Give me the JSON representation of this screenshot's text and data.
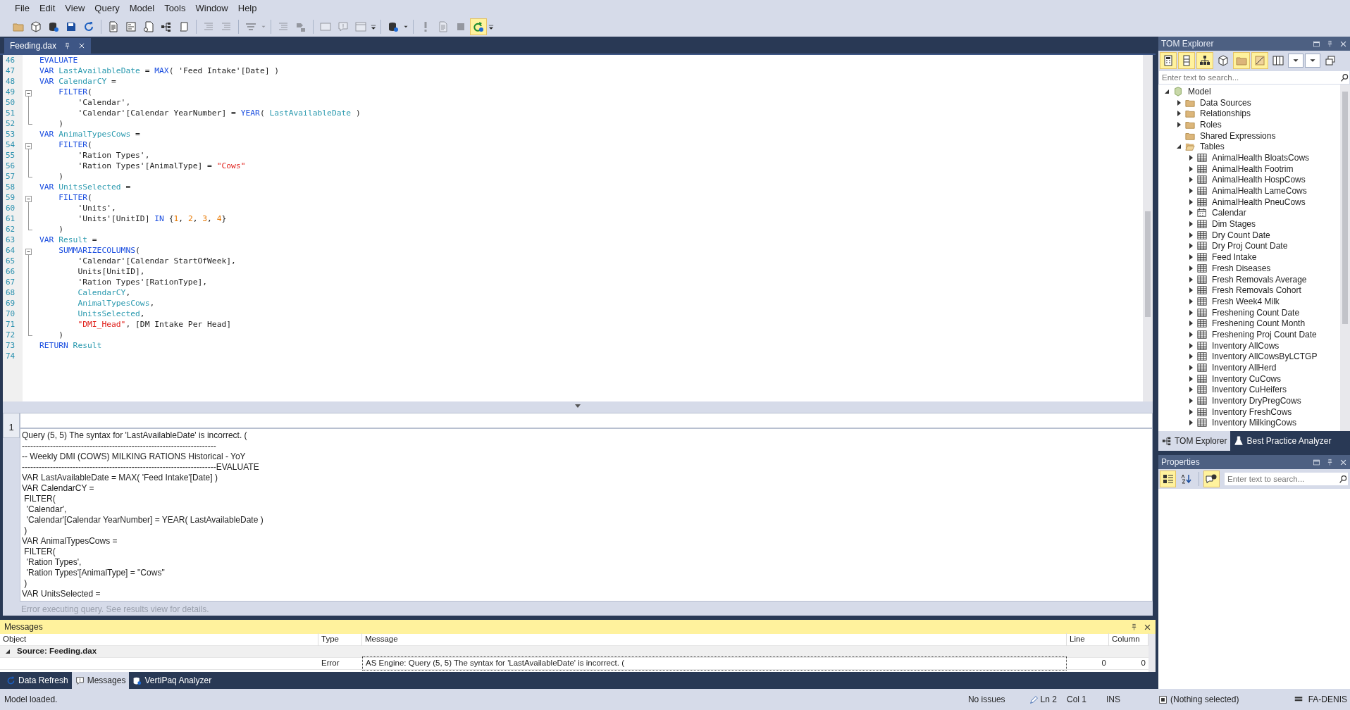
{
  "menu": [
    "File",
    "Edit",
    "View",
    "Query",
    "Model",
    "Tools",
    "Window",
    "Help"
  ],
  "toolbar": [
    {
      "kind": "folder",
      "disabled": false
    },
    {
      "kind": "cube",
      "disabled": false
    },
    {
      "kind": "database",
      "disabled": false
    },
    {
      "kind": "save",
      "disabled": false
    },
    {
      "kind": "refresh",
      "disabled": false
    },
    {
      "kind": "separator"
    },
    {
      "kind": "document",
      "disabled": false
    },
    {
      "kind": "form",
      "disabled": false
    },
    {
      "kind": "script",
      "disabled": false
    },
    {
      "kind": "tree",
      "disabled": false
    },
    {
      "kind": "scroll",
      "disabled": false
    },
    {
      "kind": "separator"
    },
    {
      "kind": "lines",
      "disabled": true
    },
    {
      "kind": "lines",
      "disabled": true
    },
    {
      "kind": "separator"
    },
    {
      "kind": "align",
      "disabled": true,
      "dropdown": true
    },
    {
      "kind": "separator"
    },
    {
      "kind": "lines",
      "disabled": true
    },
    {
      "kind": "arrow",
      "disabled": true
    },
    {
      "kind": "separator"
    },
    {
      "kind": "box",
      "disabled": true
    },
    {
      "kind": "chat",
      "disabled": true
    },
    {
      "kind": "panel",
      "disabled": true
    },
    {
      "kind": "overflow"
    },
    {
      "kind": "separator"
    },
    {
      "kind": "database",
      "disabled": false,
      "dropdown": true
    },
    {
      "kind": "separator"
    },
    {
      "kind": "exclaim",
      "disabled": true
    },
    {
      "kind": "document",
      "disabled": true
    },
    {
      "kind": "stop",
      "disabled": true
    },
    {
      "kind": "run",
      "disabled": false,
      "checked": true
    },
    {
      "kind": "overflow"
    }
  ],
  "document_tab": {
    "title": "Feeding.dax",
    "selected": true
  },
  "editor": {
    "lines": [
      {
        "number": "46",
        "kind": "plain",
        "tokens": [
          {
            "kind": "kw",
            "text": "EVALUATE"
          }
        ]
      },
      {
        "number": "47",
        "kind": "plain",
        "tokens": [
          {
            "kind": "kw",
            "text": "VAR "
          },
          {
            "kind": "var",
            "text": "LastAvailableDate"
          },
          {
            "kind": "txt",
            "text": " = "
          },
          {
            "kind": "kw",
            "text": "MAX"
          },
          {
            "kind": "txt",
            "text": "( 'Feed Intake'[Date] )"
          }
        ]
      },
      {
        "number": "48",
        "kind": "plain",
        "tokens": [
          {
            "kind": "kw",
            "text": "VAR "
          },
          {
            "kind": "var",
            "text": "CalendarCY"
          },
          {
            "kind": "txt",
            "text": " ="
          }
        ]
      },
      {
        "number": "49",
        "kind": "fold_start",
        "tokens": [
          {
            "kind": "kw",
            "text": "    FILTER"
          },
          {
            "kind": "txt",
            "text": "("
          }
        ]
      },
      {
        "number": "50",
        "kind": "fold_inside",
        "tokens": [
          {
            "kind": "txt",
            "text": "        'Calendar',"
          }
        ]
      },
      {
        "number": "51",
        "kind": "fold_inside",
        "tokens": [
          {
            "kind": "txt",
            "text": "        'Calendar'[Calendar YearNumber] = "
          },
          {
            "kind": "kw",
            "text": "YEAR"
          },
          {
            "kind": "txt",
            "text": "( "
          },
          {
            "kind": "var",
            "text": "LastAvailableDate"
          },
          {
            "kind": "txt",
            "text": " )"
          }
        ]
      },
      {
        "number": "52",
        "kind": "fold_end",
        "tokens": [
          {
            "kind": "txt",
            "text": "    )"
          }
        ]
      },
      {
        "number": "53",
        "kind": "plain",
        "tokens": [
          {
            "kind": "kw",
            "text": "VAR "
          },
          {
            "kind": "var",
            "text": "AnimalTypesCows"
          },
          {
            "kind": "txt",
            "text": " ="
          }
        ]
      },
      {
        "number": "54",
        "kind": "fold_start",
        "tokens": [
          {
            "kind": "kw",
            "text": "    FILTER"
          },
          {
            "kind": "txt",
            "text": "("
          }
        ]
      },
      {
        "number": "55",
        "kind": "fold_inside",
        "tokens": [
          {
            "kind": "txt",
            "text": "        'Ration Types',"
          }
        ]
      },
      {
        "number": "56",
        "kind": "fold_inside",
        "tokens": [
          {
            "kind": "txt",
            "text": "        'Ration Types'[AnimalType] = "
          },
          {
            "kind": "str",
            "text": "\"Cows\""
          }
        ]
      },
      {
        "number": "57",
        "kind": "fold_end",
        "tokens": [
          {
            "kind": "txt",
            "text": "    )"
          }
        ]
      },
      {
        "number": "58",
        "kind": "plain",
        "tokens": [
          {
            "kind": "kw",
            "text": "VAR "
          },
          {
            "kind": "var",
            "text": "UnitsSelected"
          },
          {
            "kind": "txt",
            "text": " ="
          }
        ]
      },
      {
        "number": "59",
        "kind": "fold_start",
        "tokens": [
          {
            "kind": "kw",
            "text": "    FILTER"
          },
          {
            "kind": "txt",
            "text": "("
          }
        ]
      },
      {
        "number": "60",
        "kind": "fold_inside",
        "tokens": [
          {
            "kind": "txt",
            "text": "        'Units',"
          }
        ]
      },
      {
        "number": "61",
        "kind": "fold_inside",
        "tokens": [
          {
            "kind": "txt",
            "text": "        'Units'[UnitID] "
          },
          {
            "kind": "kw",
            "text": "IN"
          },
          {
            "kind": "txt",
            "text": " {"
          },
          {
            "kind": "num",
            "text": "1"
          },
          {
            "kind": "txt",
            "text": ", "
          },
          {
            "kind": "num",
            "text": "2"
          },
          {
            "kind": "txt",
            "text": ", "
          },
          {
            "kind": "num",
            "text": "3"
          },
          {
            "kind": "txt",
            "text": ", "
          },
          {
            "kind": "num",
            "text": "4"
          },
          {
            "kind": "txt",
            "text": "}"
          }
        ]
      },
      {
        "number": "62",
        "kind": "fold_end",
        "tokens": [
          {
            "kind": "txt",
            "text": "    )"
          }
        ]
      },
      {
        "number": "63",
        "kind": "plain",
        "tokens": [
          {
            "kind": "kw",
            "text": "VAR "
          },
          {
            "kind": "var",
            "text": "Result"
          },
          {
            "kind": "txt",
            "text": " ="
          }
        ]
      },
      {
        "number": "64",
        "kind": "fold_start",
        "tokens": [
          {
            "kind": "kw",
            "text": "    SUMMARIZECOLUMNS"
          },
          {
            "kind": "txt",
            "text": "("
          }
        ]
      },
      {
        "number": "65",
        "kind": "fold_inside",
        "tokens": [
          {
            "kind": "txt",
            "text": "        'Calendar'[Calendar StartOfWeek],"
          }
        ]
      },
      {
        "number": "66",
        "kind": "fold_inside",
        "tokens": [
          {
            "kind": "txt",
            "text": "        Units[UnitID],"
          }
        ]
      },
      {
        "number": "67",
        "kind": "fold_inside",
        "tokens": [
          {
            "kind": "txt",
            "text": "        'Ration Types'[RationType],"
          }
        ]
      },
      {
        "number": "68",
        "kind": "fold_inside",
        "tokens": [
          {
            "kind": "var",
            "text": "        CalendarCY"
          },
          {
            "kind": "txt",
            "text": ","
          }
        ]
      },
      {
        "number": "69",
        "kind": "fold_inside",
        "tokens": [
          {
            "kind": "var",
            "text": "        AnimalTypesCows"
          },
          {
            "kind": "txt",
            "text": ","
          }
        ]
      },
      {
        "number": "70",
        "kind": "fold_inside",
        "tokens": [
          {
            "kind": "var",
            "text": "        UnitsSelected"
          },
          {
            "kind": "txt",
            "text": ","
          }
        ]
      },
      {
        "number": "71",
        "kind": "fold_inside",
        "tokens": [
          {
            "kind": "str",
            "text": "        \"DMI_Head\""
          },
          {
            "kind": "txt",
            "text": ", [DM Intake Per Head]"
          }
        ]
      },
      {
        "number": "72",
        "kind": "fold_end",
        "tokens": [
          {
            "kind": "txt",
            "text": "    )"
          }
        ]
      },
      {
        "number": "73",
        "kind": "plain",
        "tokens": [
          {
            "kind": "kw",
            "text": "RETURN "
          },
          {
            "kind": "var",
            "text": "Result"
          }
        ]
      },
      {
        "number": "74",
        "kind": "plain"
      }
    ]
  },
  "results": {
    "row_number": "1",
    "lines": [
      "Query (5, 5) The syntax for 'LastAvailableDate' is incorrect. (",
      "---------------------------------------------------------------------",
      "-- Weekly DMI (COWS) MILKING RATIONS Historical - YoY",
      "---------------------------------------------------------------------EVALUATE",
      "VAR LastAvailableDate = MAX( 'Feed Intake'[Date] )",
      "VAR CalendarCY =",
      " FILTER(",
      "  'Calendar',",
      "  'Calendar'[Calendar YearNumber] = YEAR( LastAvailableDate )",
      " )",
      "VAR AnimalTypesCows =",
      " FILTER(",
      "  'Ration Types',",
      "  'Ration Types'[AnimalType] = \"Cows\"",
      " )",
      "VAR UnitsSelected ="
    ],
    "status": "Error executing query. See results view for details."
  },
  "messages": {
    "title": "Messages",
    "columns": [
      "Object",
      "Type",
      "Message",
      "Line",
      "Column"
    ],
    "groups": [
      {
        "label": "Source: Feeding.dax",
        "expanded": true,
        "rows": [
          {
            "type": "Error",
            "message": "AS Engine: Query (5, 5) The syntax for 'LastAvailableDate' is incorrect. (",
            "line": "0",
            "column": "0"
          }
        ]
      }
    ]
  },
  "bottom_tabs": [
    {
      "label": "Data Refresh",
      "kind": "refresh",
      "selected": false
    },
    {
      "label": "Messages",
      "kind": "chat",
      "selected": true
    },
    {
      "label": "VertiPaq Analyzer",
      "kind": "database",
      "selected": false
    }
  ],
  "status_bar": {
    "message": "Model loaded.",
    "issues": "No issues",
    "line": "Ln 2",
    "col": "Col 1",
    "mode": "INS",
    "selection": "(Nothing selected)",
    "user": "FA-DENIS"
  },
  "tom_explorer": {
    "title": "TOM Explorer",
    "search": {
      "placeholder": "Enter text to search..."
    },
    "toolbar": [
      {
        "kind": "calculator",
        "checked": true
      },
      {
        "kind": "column",
        "checked": true
      },
      {
        "kind": "hierarchy",
        "checked": true
      },
      {
        "kind": "cube"
      },
      {
        "kind": "folder",
        "checked": true
      },
      {
        "kind": "formula",
        "checked": true
      },
      {
        "kind": "columns"
      },
      {
        "kind": "combo"
      },
      {
        "kind": "combo"
      },
      {
        "kind": "windows"
      }
    ],
    "tree": [
      {
        "label": "Model",
        "kind": "model",
        "expanded": true,
        "children": [
          {
            "label": "Data Sources",
            "kind": "folder",
            "expanded": false
          },
          {
            "label": "Relationships",
            "kind": "folder",
            "expanded": false
          },
          {
            "label": "Roles",
            "kind": "folder",
            "expanded": false
          },
          {
            "label": "Shared Expressions",
            "kind": "folder"
          },
          {
            "label": "Tables",
            "kind": "folder",
            "expanded": true,
            "children": [
              {
                "label": "AnimalHealth BloatsCows",
                "kind": "table",
                "expanded": false
              },
              {
                "label": "AnimalHealth Footrim",
                "kind": "table",
                "expanded": false
              },
              {
                "label": "AnimalHealth HospCows",
                "kind": "table",
                "expanded": false
              },
              {
                "label": "AnimalHealth LameCows",
                "kind": "table",
                "expanded": false
              },
              {
                "label": "AnimalHealth PneuCows",
                "kind": "table",
                "expanded": false
              },
              {
                "label": "Calendar",
                "kind": "calendar",
                "expanded": false
              },
              {
                "label": "Dim Stages",
                "kind": "table",
                "expanded": false
              },
              {
                "label": "Dry Count Date",
                "kind": "table",
                "expanded": false
              },
              {
                "label": "Dry Proj Count Date",
                "kind": "table",
                "expanded": false
              },
              {
                "label": "Feed Intake",
                "kind": "table",
                "expanded": false
              },
              {
                "label": "Fresh Diseases",
                "kind": "table",
                "expanded": false
              },
              {
                "label": "Fresh Removals Average",
                "kind": "table",
                "expanded": false
              },
              {
                "label": "Fresh Removals Cohort",
                "kind": "table",
                "expanded": false
              },
              {
                "label": "Fresh Week4 Milk",
                "kind": "table",
                "expanded": false
              },
              {
                "label": "Freshening Count Date",
                "kind": "table",
                "expanded": false
              },
              {
                "label": "Freshening Count Month",
                "kind": "table",
                "expanded": false
              },
              {
                "label": "Freshening Proj Count Date",
                "kind": "table",
                "expanded": false
              },
              {
                "label": "Inventory AllCows",
                "kind": "table",
                "expanded": false
              },
              {
                "label": "Inventory AllCowsByLCTGP",
                "kind": "table",
                "expanded": false
              },
              {
                "label": "Inventory AllHerd",
                "kind": "table",
                "expanded": false
              },
              {
                "label": "Inventory CuCows",
                "kind": "table",
                "expanded": false
              },
              {
                "label": "Inventory CuHeifers",
                "kind": "table",
                "expanded": false
              },
              {
                "label": "Inventory DryPregCows",
                "kind": "table",
                "expanded": false
              },
              {
                "label": "Inventory FreshCows",
                "kind": "table",
                "expanded": false
              },
              {
                "label": "Inventory MilkingCows",
                "kind": "table",
                "expanded": false
              }
            ]
          }
        ]
      }
    ]
  },
  "side_tabs": [
    {
      "label": "TOM Explorer",
      "kind": "tree",
      "selected": true
    },
    {
      "label": "Best Practice Analyzer",
      "kind": "flask",
      "selected": false
    }
  ],
  "properties": {
    "title": "Properties",
    "search": {
      "placeholder": "Enter text to search..."
    },
    "toolbar": [
      {
        "kind": "categorized",
        "checked": true
      },
      {
        "kind": "sort"
      },
      {
        "kind": "separator"
      },
      {
        "kind": "info",
        "checked": true
      }
    ]
  }
}
